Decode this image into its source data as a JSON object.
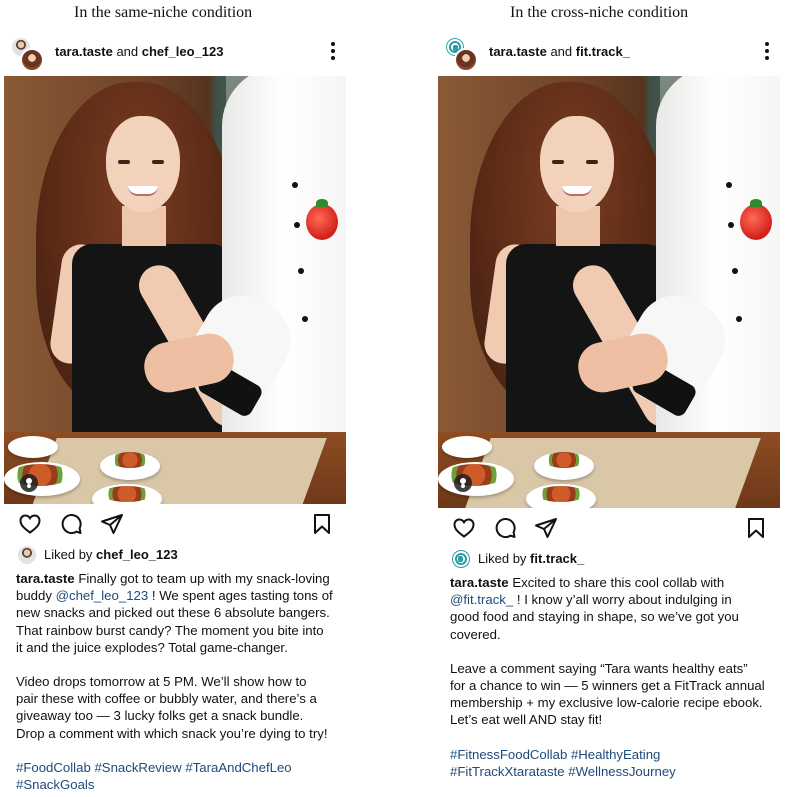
{
  "left": {
    "condition_title": "In the same-niche condition",
    "header": {
      "user1": "tara.taste",
      "and": "and",
      "user2": "chef_leo_123"
    },
    "liked_by": {
      "prefix": "Liked by",
      "user": "chef_leo_123"
    },
    "caption": {
      "handle": "tara.taste",
      "lines": [
        " Finally got to team up with my snack-loving",
        [
          "buddy ",
          "@chef_leo_123",
          " ! We spent ages tasting tons of"
        ],
        "new snacks and picked out these 6 absolute bangers.",
        "That rainbow burst candy? The moment you bite into",
        "it and the juice explodes? Total game-changer."
      ],
      "para2": [
        "Video drops tomorrow at 5 PM. We’ll show how to",
        "pair these with coffee or bubbly water, and there’s a",
        "giveaway too — 3 lucky folks get a snack bundle.",
        "Drop a comment with which snack you’re dying to try!"
      ],
      "hashtags": [
        "#FoodCollab #SnackReview #TaraAndChefLeo",
        "#SnackGoals"
      ]
    }
  },
  "right": {
    "condition_title": "In the cross-niche condition",
    "header": {
      "user1": "tara.taste",
      "and": "and",
      "user2": "fit.track_"
    },
    "liked_by": {
      "prefix": "Liked by",
      "user": "fit.track_"
    },
    "caption": {
      "handle": "tara.taste",
      "lines": [
        " Excited to share this cool collab with",
        [
          "",
          "@fit.track_",
          " ! I know y’all worry about indulging in"
        ],
        "good food and staying in shape, so we’ve got you",
        "covered."
      ],
      "para2": [
        "Leave a comment saying “Tara wants healthy eats”",
        "for a chance to win — 5 winners get a FitTrack annual",
        "membership + my exclusive low-calorie recipe ebook.",
        "Let’s eat well AND stay fit!"
      ],
      "hashtags": [
        "#FitnessFoodCollab #HealthyEating",
        "#FitTrackXtarataste #WellnessJourney"
      ]
    }
  },
  "icons": [
    "more-icon",
    "heart-icon",
    "comment-icon",
    "share-icon",
    "bookmark-icon",
    "tag-user-icon"
  ],
  "colors": {
    "mention": "#1f4a7a",
    "fit_brand": "#2a9aa3"
  }
}
